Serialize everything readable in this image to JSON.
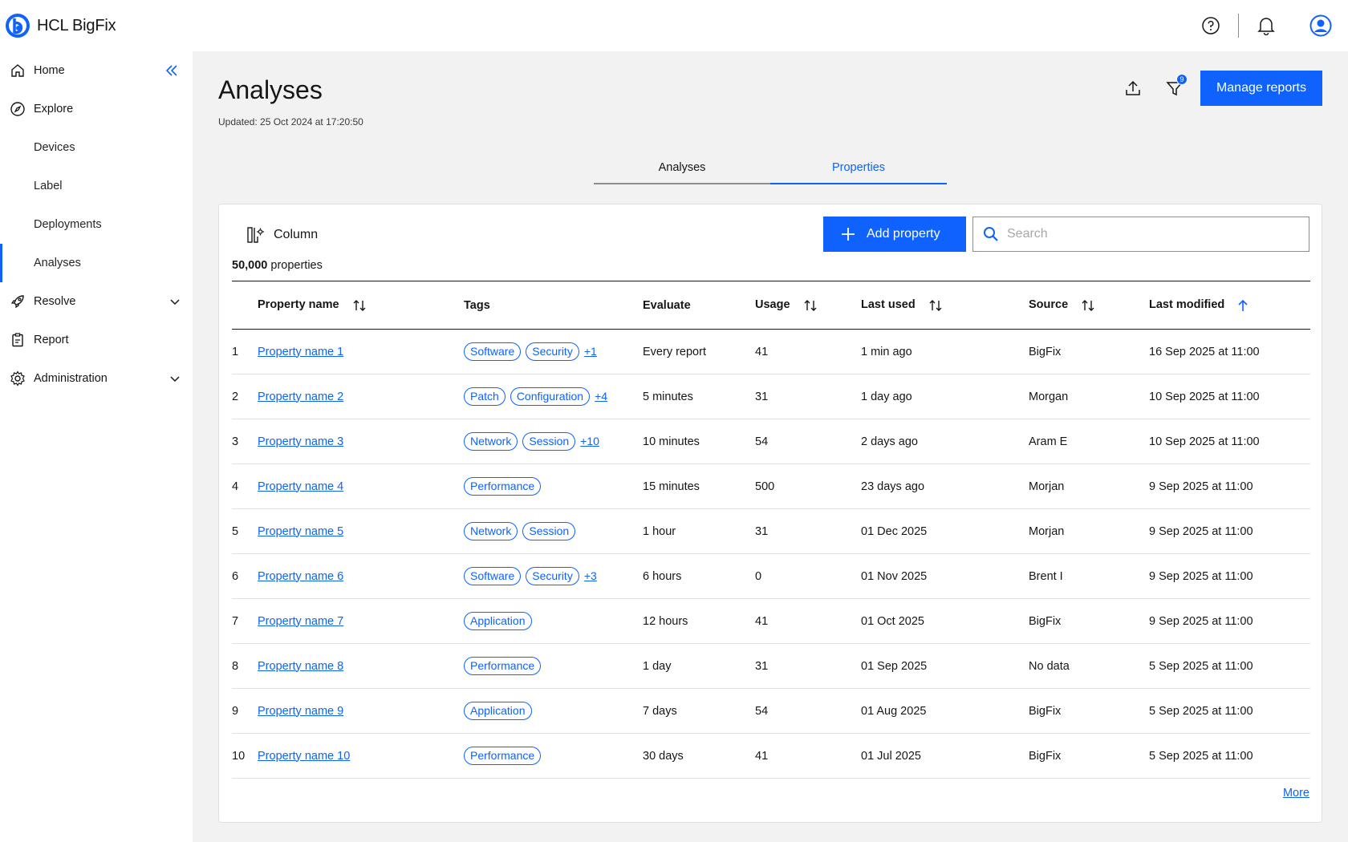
{
  "brand": {
    "name": "HCL BigFix"
  },
  "sidebar": {
    "items": [
      {
        "label": "Home",
        "icon": "home-icon"
      },
      {
        "label": "Explore",
        "icon": "compass-icon"
      },
      {
        "label": "Devices"
      },
      {
        "label": "Label"
      },
      {
        "label": "Deployments"
      },
      {
        "label": "Analyses"
      },
      {
        "label": "Resolve",
        "icon": "rocket-icon"
      },
      {
        "label": "Report",
        "icon": "clipboard-icon"
      },
      {
        "label": "Administration",
        "icon": "gear-icon"
      }
    ],
    "active": "Analyses"
  },
  "header": {
    "title": "Analyses",
    "updated": "Updated: 25 Oct 2024 at 17:20:50",
    "filter_count": "9",
    "manage_label": "Manage reports"
  },
  "tabs": [
    {
      "label": "Analyses"
    },
    {
      "label": "Properties"
    }
  ],
  "active_tab": "Properties",
  "toolbar": {
    "column_label": "Column",
    "add_label": "Add property",
    "search_placeholder": "Search",
    "count_number": "50,000",
    "count_suffix": "properties"
  },
  "table": {
    "headers": [
      "Property name",
      "Tags",
      "Evaluate",
      "Usage",
      "Last used",
      "Source",
      "Last modified"
    ],
    "rows": [
      {
        "num": "1",
        "name": "Property name 1",
        "tags": [
          "Software",
          "Security"
        ],
        "extra": "+1",
        "evaluate": "Every report",
        "usage": "41",
        "last_used": "1 min ago",
        "source": "BigFix",
        "modified": "16 Sep 2025 at 11:00"
      },
      {
        "num": "2",
        "name": "Property name 2",
        "tags": [
          "Patch",
          "Configuration"
        ],
        "extra": "+4",
        "evaluate": "5 minutes",
        "usage": "31",
        "last_used": "1 day ago",
        "source": "Morgan",
        "modified": "10 Sep 2025 at 11:00"
      },
      {
        "num": "3",
        "name": "Property name 3",
        "tags": [
          "Network",
          "Session"
        ],
        "extra": "+10",
        "evaluate": "10 minutes",
        "usage": "54",
        "last_used": "2 days ago",
        "source": "Aram E",
        "modified": "10 Sep 2025 at 11:00"
      },
      {
        "num": "4",
        "name": "Property name 4",
        "tags": [
          "Performance"
        ],
        "extra": "",
        "evaluate": "15 minutes",
        "usage": "500",
        "last_used": "23 days ago",
        "source": "Morjan",
        "modified": "9 Sep 2025 at 11:00"
      },
      {
        "num": "5",
        "name": "Property name 5",
        "tags": [
          "Network",
          "Session"
        ],
        "extra": "",
        "evaluate": "1 hour",
        "usage": "31",
        "last_used": "01 Dec 2025",
        "source": "Morjan",
        "modified": "9 Sep 2025 at 11:00"
      },
      {
        "num": "6",
        "name": "Property name 6",
        "tags": [
          "Software",
          "Security"
        ],
        "extra": "+3",
        "evaluate": "6 hours",
        "usage": "0",
        "last_used": "01 Nov 2025",
        "source": "Brent I",
        "modified": "9 Sep 2025 at 11:00"
      },
      {
        "num": "7",
        "name": "Property name 7",
        "tags": [
          "Application"
        ],
        "extra": "",
        "evaluate": "12 hours",
        "usage": "41",
        "last_used": "01 Oct 2025",
        "source": "BigFix",
        "modified": "9 Sep 2025 at 11:00"
      },
      {
        "num": "8",
        "name": "Property name 8",
        "tags": [
          "Performance"
        ],
        "extra": "",
        "evaluate": "1 day",
        "usage": "31",
        "last_used": "01 Sep 2025",
        "source": "No data",
        "modified": "5 Sep 2025 at 11:00"
      },
      {
        "num": "9",
        "name": "Property name 9",
        "tags": [
          "Application"
        ],
        "extra": "",
        "evaluate": "7 days",
        "usage": "54",
        "last_used": "01 Aug 2025",
        "source": "BigFix",
        "modified": "5 Sep 2025 at 11:00"
      },
      {
        "num": "10",
        "name": "Property name 10",
        "tags": [
          "Performance"
        ],
        "extra": "",
        "evaluate": "30 days",
        "usage": "41",
        "last_used": "01 Jul 2025",
        "source": "BigFix",
        "modified": "5 Sep 2025 at 11:00"
      }
    ]
  },
  "more_label": "More",
  "colors": {
    "accent": "#0f62fe",
    "page_bg": "#f2f2f2",
    "text": "#161616"
  }
}
